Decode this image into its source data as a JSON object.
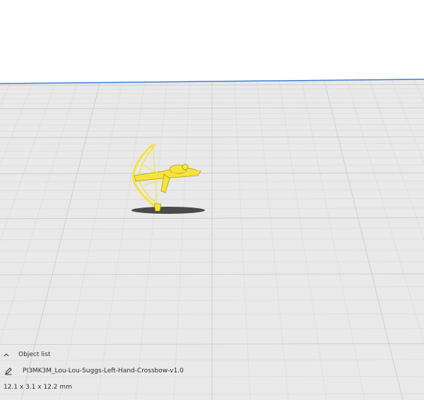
{
  "colors": {
    "background": "#ffffff",
    "buildplate": "#e9e9e9",
    "grid_fine": "#dcdcdc",
    "grid_major": "#c9c9c9",
    "buildplate_edge": "#3d7fd6",
    "model": "#f6e33c",
    "model_outline": "#b59c10",
    "shadow": "#4a4a4a"
  },
  "icons": {
    "collapse": "chevron-up-icon",
    "edit": "pencil-icon"
  },
  "object_list": {
    "toggle_label": "Object list",
    "object_name": "PI3MK3M_Lou-Lou-Suggs-Left-Hand-Crossbow-v1.0",
    "dimensions": "12.1 x 3.1 x 12.2 mm"
  }
}
